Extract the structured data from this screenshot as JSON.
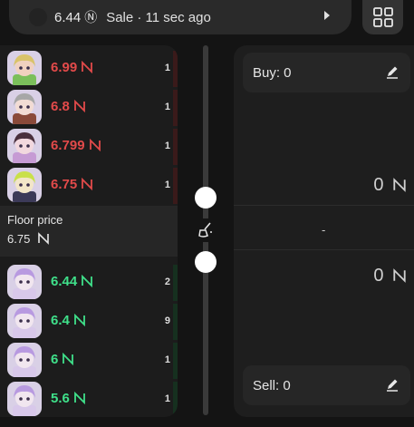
{
  "ticker": {
    "price": "6.44",
    "event": "Sale · 11 sec ago"
  },
  "asks": [
    {
      "price": "6.99",
      "qty": "1",
      "hair": "#d9c36a",
      "skin": "#f1d1bf",
      "shirt": "#7bbf5b"
    },
    {
      "price": "6.8",
      "qty": "1",
      "hair": "#a7a7a7",
      "skin": "#f2dcd4",
      "shirt": "#8a4a3a"
    },
    {
      "price": "6.799",
      "qty": "1",
      "hair": "#4a2f3c",
      "skin": "#f2d8de",
      "shirt": "#c69bd4"
    },
    {
      "price": "6.75",
      "qty": "1",
      "hair": "#c9e04a",
      "skin": "#f3e6c8",
      "shirt": "#3c3a58"
    }
  ],
  "floor": {
    "label": "Floor price",
    "value": "6.75"
  },
  "bids": [
    {
      "price": "6.44",
      "qty": "2",
      "hair": "#b89ae0",
      "skin": "#f1e6ef",
      "shirt": "#d8c8ea"
    },
    {
      "price": "6.4",
      "qty": "9",
      "hair": "#b89ae0",
      "skin": "#f1e6ef",
      "shirt": "#d8c8ea"
    },
    {
      "price": "6",
      "qty": "1",
      "hair": "#b89ae0",
      "skin": "#f1e6ef",
      "shirt": "#d8c8ea"
    },
    {
      "price": "5.6",
      "qty": "1",
      "hair": "#b89ae0",
      "skin": "#f1e6ef",
      "shirt": "#d8c8ea"
    }
  ],
  "panel": {
    "buy_label": "Buy: 0",
    "buy_amount": "0",
    "spread": "-",
    "sell_amount": "0",
    "sell_label": "Sell: 0"
  },
  "icons": [
    "near-icon",
    "play-icon",
    "grid-icon",
    "broom-icon",
    "edit-icon"
  ],
  "colors": {
    "ask": "#e24a4a",
    "bid": "#3fe08a"
  }
}
